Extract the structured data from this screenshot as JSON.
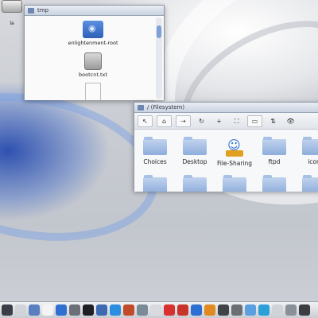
{
  "colors": {
    "accent": "#6f97cf",
    "scroll_thumb": "#7ea0d6"
  },
  "desktop": {
    "icon_label": "la",
    "drive_icon": "hard-drive-icon"
  },
  "tmp_window": {
    "title": "tmp",
    "items": [
      {
        "label": "enlightenment-root",
        "icon": "special-folder-icon"
      },
      {
        "label": "bootcnt.txt",
        "icon": "disk-image-icon"
      },
      {
        "label": "",
        "icon": "document-icon"
      }
    ]
  },
  "fm_window": {
    "title": "/ (Filesystem)",
    "toolbar": {
      "buttons": [
        {
          "icon": "up-arrow-icon",
          "glyph": "↖"
        },
        {
          "icon": "home-icon",
          "glyph": "⌂"
        },
        {
          "icon": "forward-back-icon",
          "glyph": "⇢"
        },
        {
          "icon": "refresh-icon",
          "glyph": "↻"
        },
        {
          "icon": "new-folder-icon",
          "glyph": "+"
        },
        {
          "icon": "expand-icon",
          "glyph": "⛶"
        },
        {
          "icon": "view-mode-icon",
          "glyph": "▭"
        },
        {
          "icon": "sort-icon",
          "glyph": "⇅"
        },
        {
          "icon": "show-hidden-icon",
          "glyph": "👁"
        }
      ]
    },
    "folders_row1": [
      {
        "label": "Choices",
        "icon": "folder-icon"
      },
      {
        "label": "Desktop",
        "icon": "folder-icon"
      },
      {
        "label": "File-Sharing",
        "icon": "file-sharing-icon"
      },
      {
        "label": "ftpd",
        "icon": "folder-icon"
      },
      {
        "label": "icon",
        "icon": "folder-icon"
      }
    ],
    "folders_row2": [
      {
        "label": "",
        "icon": "folder-icon"
      },
      {
        "label": "",
        "icon": "folder-icon"
      },
      {
        "label": "",
        "icon": "folder-icon"
      },
      {
        "label": "",
        "icon": "folder-icon"
      },
      {
        "label": "",
        "icon": "folder-icon"
      }
    ]
  },
  "taskbar": {
    "icons": [
      "start-menu-icon",
      "window-list-icon",
      "files-icon",
      "blank-icon",
      "media-icon",
      "terminal-icon",
      "monitor-icon",
      "image-viewer-icon",
      "chat-icon",
      "music-icon",
      "web-icon",
      "printer-icon",
      "car-icon",
      "red-app-icon",
      "browser-icon",
      "color-icon",
      "camera-icon",
      "tools-icon",
      "paint-icon",
      "audio-icon",
      "calendar-icon",
      "trash-icon",
      "power-icon"
    ]
  }
}
